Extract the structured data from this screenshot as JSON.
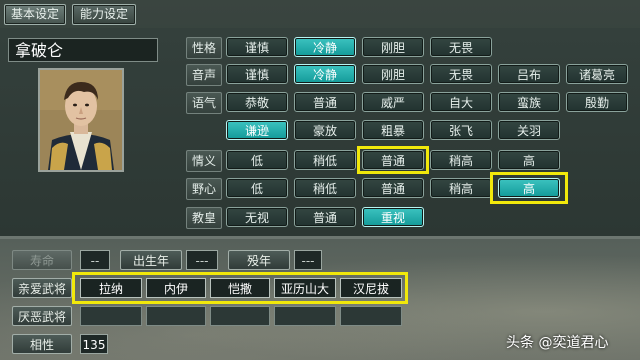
{
  "tabs": [
    "基本设定",
    "能力设定"
  ],
  "officer_name": "拿破仑",
  "portrait_icon": "napoleon-portrait",
  "accent_colors": {
    "selected": "#1fb2b0",
    "highlight": "#f1e80b"
  },
  "attributes": {
    "xingge": {
      "label": "性格",
      "options": [
        "谨慎",
        "冷静",
        "刚胆",
        "无畏"
      ],
      "selected": "冷静"
    },
    "yinsheng": {
      "label": "音声",
      "options": [
        "谨慎",
        "冷静",
        "刚胆",
        "无畏",
        "吕布",
        "诸葛亮"
      ],
      "selected": "冷静"
    },
    "yuqi": {
      "label": "语气",
      "options_row1": [
        "恭敬",
        "普通",
        "威严",
        "自大",
        "蛮族",
        "殷勤"
      ],
      "options_row2": [
        "谦逊",
        "豪放",
        "粗暴",
        "张飞",
        "关羽"
      ],
      "selected": "谦逊"
    },
    "qingyi": {
      "label": "情义",
      "options": [
        "低",
        "稍低",
        "普通",
        "稍高",
        "高"
      ],
      "selected": "普通"
    },
    "yexin": {
      "label": "野心",
      "options": [
        "低",
        "稍低",
        "普通",
        "稍高",
        "高"
      ],
      "selected": "高"
    },
    "jiaohuang": {
      "label": "教皇",
      "options": [
        "无视",
        "普通",
        "重视"
      ],
      "selected": "重视"
    }
  },
  "life": {
    "lifespan_label": "寿命",
    "lifespan_value": "--",
    "birth_label": "出生年",
    "birth_value": "---",
    "death_label": "殁年",
    "death_value": "---"
  },
  "favored_generals": {
    "label": "亲爱武将",
    "names": [
      "拉纳",
      "内伊",
      "恺撒",
      "亚历山大",
      "汉尼拔"
    ]
  },
  "disliked_generals": {
    "label": "厌恶武将",
    "names": []
  },
  "compatibility": {
    "label": "相性",
    "value": "135"
  },
  "watermark": "头条 @奕道君心"
}
